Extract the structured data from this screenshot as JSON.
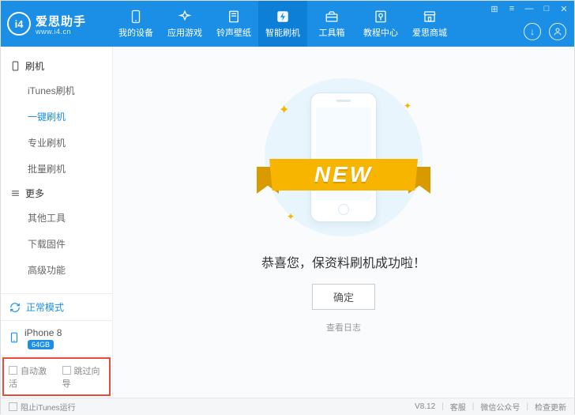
{
  "brand": {
    "name": "爱思助手",
    "url": "www.i4.cn",
    "logo_text": "i4"
  },
  "nav": {
    "items": [
      {
        "label": "我的设备",
        "icon": "phone"
      },
      {
        "label": "应用游戏",
        "icon": "apps"
      },
      {
        "label": "铃声壁纸",
        "icon": "note"
      },
      {
        "label": "智能刷机",
        "icon": "flash",
        "active": true
      },
      {
        "label": "工具箱",
        "icon": "toolbox"
      },
      {
        "label": "教程中心",
        "icon": "book"
      },
      {
        "label": "爱思商城",
        "icon": "shop"
      }
    ]
  },
  "win_controls": {
    "lock": "⊞",
    "skin": "≡",
    "min": "—",
    "max": "□",
    "close": "✕"
  },
  "header_icons": {
    "download": "↓",
    "user": "👤"
  },
  "sidebar": {
    "groups": [
      {
        "title": "刷机",
        "icon": "phone-o",
        "items": [
          {
            "label": "iTunes刷机"
          },
          {
            "label": "一键刷机",
            "active": true
          },
          {
            "label": "专业刷机"
          },
          {
            "label": "批量刷机"
          }
        ]
      },
      {
        "title": "更多",
        "icon": "menu",
        "items": [
          {
            "label": "其他工具"
          },
          {
            "label": "下载固件"
          },
          {
            "label": "高级功能"
          }
        ]
      }
    ],
    "mode": {
      "icon": "refresh",
      "label": "正常模式"
    },
    "device": {
      "icon": "phone-o",
      "name": "iPhone 8",
      "badge": "64GB"
    },
    "checks": {
      "auto_activate": "自动激活",
      "skip_guide": "跳过向导"
    }
  },
  "main": {
    "ribbon": "NEW",
    "success": "恭喜您，保资料刷机成功啦！",
    "ok": "确定",
    "log": "查看日志"
  },
  "footer": {
    "block_itunes": "阻止iTunes运行",
    "version": "V8.12",
    "support": "客服",
    "wechat": "微信公众号",
    "update": "检查更新"
  }
}
